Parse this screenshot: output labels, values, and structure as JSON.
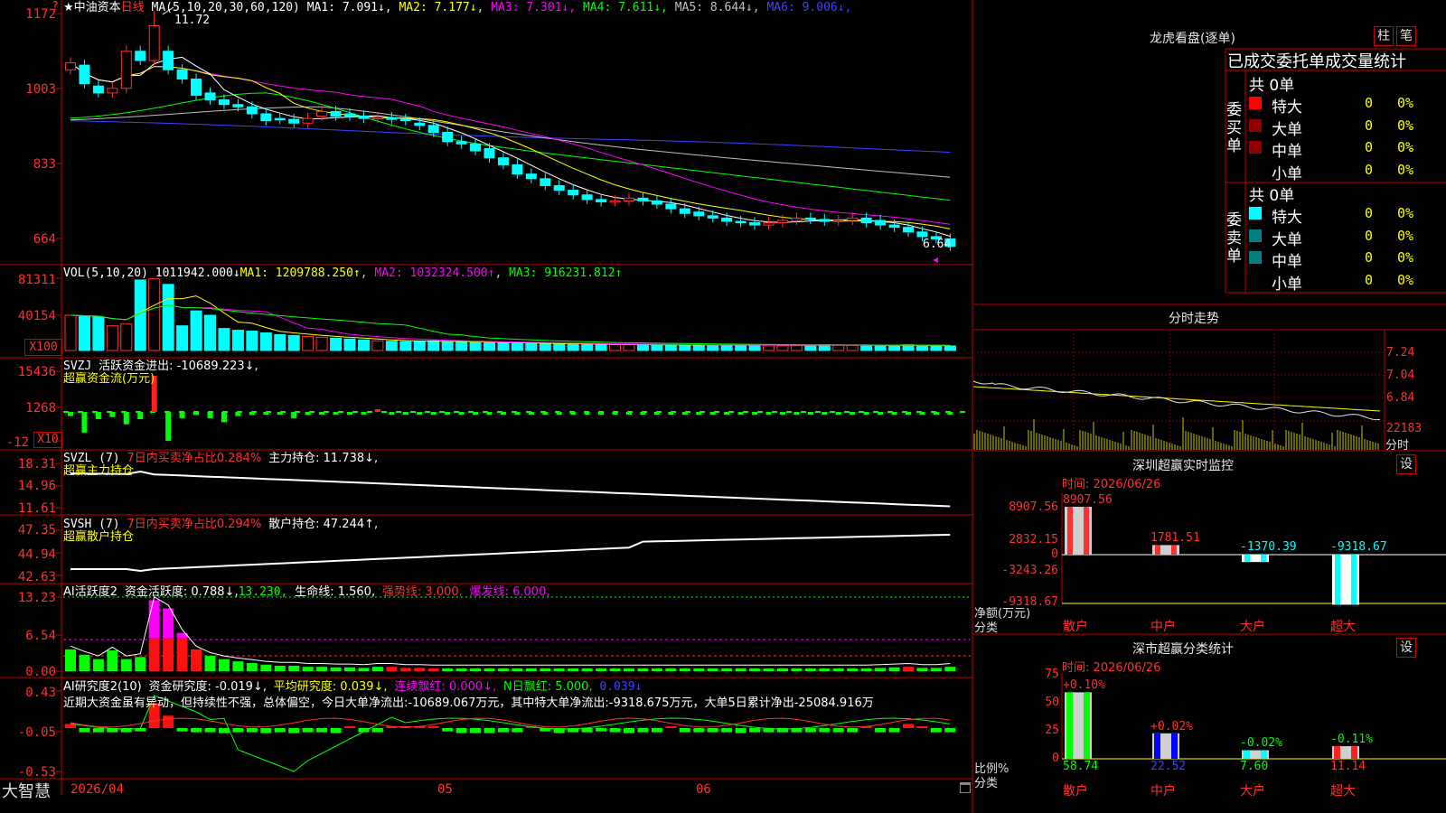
{
  "stock": {
    "star": "★",
    "name": "中油资本",
    "period": "日线",
    "arrow_top": "?"
  },
  "price_panel": {
    "ma_params": "MA(5,10,20,30,60,120)",
    "ma": [
      {
        "label": "MA1: 7.091↓",
        "color": "#ffffff"
      },
      {
        "label": "MA2: 7.177↓",
        "color": "#ffff00"
      },
      {
        "label": "MA3: 7.301↓",
        "color": "#ff00ff"
      },
      {
        "label": "MA4: 7.611↓",
        "color": "#00ff00"
      },
      {
        "label": "MA5: 8.644↓",
        "color": "#c0c0c0"
      },
      {
        "label": "MA6: 9.006↓",
        "color": "#4040ff"
      }
    ],
    "y_ticks": [
      "1172",
      "1003",
      "833",
      "664"
    ],
    "high_note": "11.72",
    "low_note": "6.64"
  },
  "vol_panel": {
    "header": "VOL(5,10,20)",
    "value": "1011942.000↓",
    "ma1": "MA1: 1209788.250↑",
    "ma2": "MA2: 1032324.500↑",
    "ma3": "MA3: 916231.812↑",
    "y_ticks": [
      "81311",
      "40154"
    ],
    "unit": "X100"
  },
  "svzj_panel": {
    "header": "SVZJ",
    "title": "活跃资金进出: -10689.223↓,",
    "subtitle": "超赢资金流(万元)",
    "y_ticks": [
      "15436",
      "1268",
      "-12"
    ],
    "unit": "X10"
  },
  "svzl_panel": {
    "header": "SVZL (7)",
    "ratio": "7日内买卖净占比0.284%",
    "hold": "主力持仓: 11.738↓,",
    "subtitle": "超赢主力持仓",
    "y_ticks": [
      "18.31",
      "14.96",
      "11.61"
    ]
  },
  "svsh_panel": {
    "header": "SVSH (7)",
    "ratio": "7日内买卖净占比0.294%",
    "hold": "散户持仓: 47.244↑,",
    "subtitle": "超赢散户持仓",
    "y_ticks": [
      "47.35",
      "44.94",
      "42.63"
    ]
  },
  "ai_active_panel": {
    "header": "AI活跃度2",
    "a1": "资金活跃度: 0.788↓,",
    "a2": "13.230,",
    "a3": "生命线: 1.560,",
    "a4": "强势线: 3.000,",
    "a5": "爆发线: 6.000,",
    "y_ticks": [
      "13.23",
      "6.54",
      "0.00"
    ]
  },
  "ai_research_panel": {
    "header": "AI研究度2(10)",
    "r1": "资金研究度: -0.019↓,",
    "r2": "平均研究度: 0.039↓,",
    "r3": "连续飘红: 0.000↓,",
    "r4": "N日飘红: 5.000,",
    "r5": "0.039↓",
    "comment": "近期大资金虽有异动，但持续性不强，总体偏空，今日大单净流出:-10689.067万元，其中特大单净流出:-9318.675万元，大单5日累计净出-25084.916万",
    "y_ticks": [
      "0.43",
      "-0.05",
      "-0.53"
    ]
  },
  "x_axis": {
    "labels": [
      "2026/04",
      "05",
      "06"
    ],
    "brand": "大智慧"
  },
  "longhu": {
    "title": "龙虎看盘(逐单)",
    "btn_bar": "柱",
    "btn_pen": "笔",
    "subtitle": "已成交委托单成交量统计",
    "buy_label": "委买单",
    "sell_label": "委卖单",
    "buy_total": "共 0单",
    "sell_total": "共 0单",
    "rows": [
      {
        "name": "特大",
        "count": "0",
        "pct": "0%"
      },
      {
        "name": "大单",
        "count": "0",
        "pct": "0%"
      },
      {
        "name": "中单",
        "count": "0",
        "pct": "0%"
      },
      {
        "name": "小单",
        "count": "0",
        "pct": "0%"
      }
    ]
  },
  "intraday": {
    "title": "分时走势",
    "y_ticks": [
      "7.24",
      "7.04",
      "6.84"
    ],
    "vol_label": "22183",
    "time_label": "分时"
  },
  "sz_monitor": {
    "title": "深圳超赢实时监控",
    "setting": "设",
    "time": "时间: 2026/06/26",
    "y_ticks": [
      "8907.56",
      "2832.15",
      "0",
      "-3243.26",
      "-9318.67"
    ],
    "unit": "净额(万元)",
    "cat_label": "分类",
    "bars": [
      {
        "name": "散户",
        "value": 8907.56,
        "label": "8907.56"
      },
      {
        "name": "中户",
        "value": 1781.51,
        "label": "1781.51"
      },
      {
        "name": "大户",
        "value": -1370.39,
        "label": "-1370.39"
      },
      {
        "name": "超大",
        "value": -9318.67,
        "label": "-9318.67"
      }
    ]
  },
  "sz_stats": {
    "title": "深市超赢分类统计",
    "setting": "设",
    "time": "时间: 2026/06/26",
    "y_ticks": [
      "75",
      "50",
      "25",
      "0"
    ],
    "unit": "比例%",
    "cat_label": "分类",
    "bars": [
      {
        "name": "散户",
        "value": 58.74,
        "label": "58.74",
        "change": "+0.10%"
      },
      {
        "name": "中户",
        "value": 22.52,
        "label": "22.52",
        "change": "+0.02%"
      },
      {
        "name": "大户",
        "value": 7.6,
        "label": "7.60",
        "change": "-0.02%"
      },
      {
        "name": "超大",
        "value": 11.14,
        "label": "11.14",
        "change": "-0.11%"
      }
    ]
  },
  "chart_data": [
    {
      "type": "candlestick",
      "title": "中油资本 日线",
      "ylim": [
        6.4,
        11.8
      ],
      "open": [
        10.45,
        10.55,
        10.1,
        9.95,
        10.05,
        10.85,
        10.65,
        10.85,
        10.45,
        10.25,
        9.95,
        9.8,
        9.7,
        9.65,
        9.5,
        9.4,
        9.38,
        9.3,
        9.45,
        9.55,
        9.5,
        9.45,
        9.4,
        9.42,
        9.38,
        9.3,
        9.25,
        9.1,
        8.9,
        8.85,
        8.75,
        8.55,
        8.4,
        8.2,
        8.1,
        7.95,
        7.85,
        7.75,
        7.65,
        7.6,
        7.62,
        7.68,
        7.62,
        7.55,
        7.45,
        7.38,
        7.3,
        7.25,
        7.18,
        7.15,
        7.1,
        7.15,
        7.2,
        7.25,
        7.22,
        7.18,
        7.2,
        7.25,
        7.2,
        7.1,
        7.05,
        6.95,
        6.85,
        6.8
      ],
      "close": [
        10.6,
        10.15,
        9.95,
        10.05,
        10.85,
        10.65,
        11.4,
        10.45,
        10.25,
        9.9,
        9.8,
        9.7,
        9.65,
        9.5,
        9.35,
        9.38,
        9.3,
        9.4,
        9.55,
        9.45,
        9.45,
        9.4,
        9.42,
        9.38,
        9.35,
        9.25,
        9.1,
        8.9,
        8.85,
        8.7,
        8.55,
        8.4,
        8.2,
        8.1,
        7.95,
        7.85,
        7.75,
        7.65,
        7.6,
        7.62,
        7.68,
        7.62,
        7.55,
        7.45,
        7.35,
        7.3,
        7.25,
        7.18,
        7.15,
        7.1,
        7.15,
        7.2,
        7.25,
        7.22,
        7.18,
        7.2,
        7.25,
        7.15,
        7.1,
        7.05,
        6.95,
        6.85,
        6.8,
        6.64
      ],
      "note": "11.72 high, 6.64 last"
    },
    {
      "type": "bar",
      "title": "VOL(5,10,20)",
      "ylim": [
        0,
        82000
      ],
      "values": [
        40000,
        39000,
        38000,
        28000,
        30000,
        80000,
        81311,
        75000,
        28000,
        45000,
        40000,
        25000,
        23000,
        22000,
        20000,
        18000,
        17000,
        16000,
        15000,
        14000,
        13000,
        12000,
        11000,
        10500,
        10000,
        10500,
        11000,
        10000,
        9500,
        9000,
        8800,
        8500,
        8300,
        8000,
        7800,
        7500,
        7300,
        7000,
        6800,
        6700,
        6600,
        6500,
        6400,
        6300,
        6200,
        6100,
        6000,
        6500,
        6200,
        6000,
        5800,
        5600,
        6000,
        6200,
        6500,
        6000,
        5800,
        6200,
        5500,
        5300,
        6500,
        5400,
        5800,
        5200
      ]
    },
    {
      "type": "bar",
      "title": "活跃资金进出",
      "ylim": [
        -1400,
        15436
      ],
      "values": [
        -400,
        -2000,
        -700,
        -500,
        -1200,
        -700,
        3500,
        -2800,
        -600,
        -300,
        -600,
        -1000,
        -400,
        -300,
        -100,
        -200,
        -600,
        -300,
        -200,
        -100,
        -50,
        -100,
        200,
        -150,
        -100,
        -80,
        -100,
        -60,
        -50,
        -40,
        -60,
        -30,
        -40,
        -50,
        -20,
        -40,
        -30,
        -50,
        -40,
        -30,
        -40,
        -30,
        -40,
        -30,
        -20,
        -30,
        -25,
        -20,
        -30,
        -20,
        -15,
        -20,
        -25,
        -30,
        -20,
        -15,
        -10,
        -20,
        -15,
        -10,
        -12,
        -10,
        -15,
        -10
      ]
    }
  ]
}
